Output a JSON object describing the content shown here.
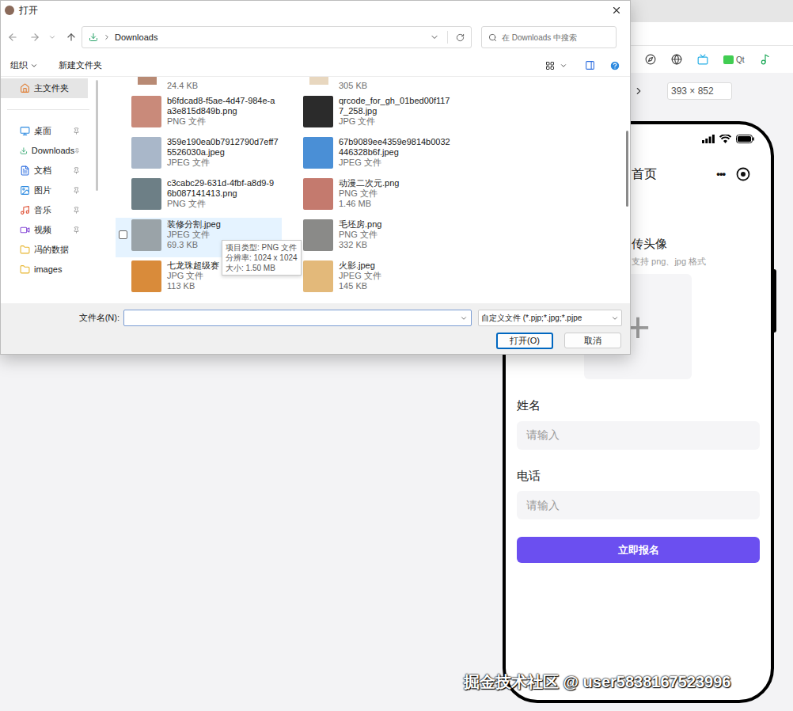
{
  "dialog": {
    "title": "打开",
    "address": {
      "path": "Downloads"
    },
    "search": {
      "placeholder": "在 Downloads 中搜索"
    },
    "toolbar": {
      "organize": "组织",
      "new_folder": "新建文件夹"
    },
    "nav": [
      {
        "label": "主文件夹",
        "selected": true,
        "pinned": false
      },
      {
        "label": "桌面",
        "selected": false,
        "pinned": true
      },
      {
        "label": "Downloads",
        "selected": false,
        "pinned": true
      },
      {
        "label": "文档",
        "selected": false,
        "pinned": true
      },
      {
        "label": "图片",
        "selected": false,
        "pinned": true
      },
      {
        "label": "音乐",
        "selected": false,
        "pinned": true
      },
      {
        "label": "视频",
        "selected": false,
        "pinned": true
      },
      {
        "label": "冯的数据",
        "selected": false,
        "pinned": false
      },
      {
        "label": "images",
        "selected": false,
        "pinned": false
      }
    ],
    "partial_row": [
      "24.4 KB",
      "305 KB"
    ],
    "files": [
      {
        "name_lines": [
          "b6fdcad8-f5ae-4d47-984e-a",
          "a3e815d849b.png"
        ],
        "type": "PNG 文件",
        "hovered": false,
        "checked": false
      },
      {
        "name_lines": [
          "qrcode_for_gh_01bed00f117",
          "7_258.jpg"
        ],
        "type": "JPG 文件",
        "hovered": false,
        "checked": false
      },
      {
        "name_lines": [
          "359e190ea0b7912790d7eff7",
          "5526030a.jpeg"
        ],
        "type": "JPEG 文件",
        "hovered": false,
        "checked": false
      },
      {
        "name_lines": [
          "67b9089ee4359e9814b0032",
          "446328b6f.jpeg"
        ],
        "type": "JPEG 文件",
        "hovered": false,
        "checked": false
      },
      {
        "name_lines": [
          "c3cabc29-631d-4fbf-a8d9-9",
          "6b087141413.png"
        ],
        "type": "PNG 文件",
        "hovered": false,
        "checked": false
      },
      {
        "name_lines": [
          "动漫二次元.png"
        ],
        "type": "PNG 文件",
        "size": "1.46 MB",
        "hovered": false,
        "checked": false
      },
      {
        "name_lines": [
          "装修分割.jpeg"
        ],
        "type": "JPEG 文件",
        "size": "69.3 KB",
        "hovered": true,
        "checked": false
      },
      {
        "name_lines": [
          "毛坯房.png"
        ],
        "type": "PNG 文件",
        "size": "332 KB",
        "hovered": false,
        "checked": false
      },
      {
        "name_lines": [
          "七龙珠超级赛"
        ],
        "type": "JPG 文件",
        "size": "113 KB",
        "hovered": false,
        "checked": false
      },
      {
        "name_lines": [
          "火影.jpeg"
        ],
        "type": "JPEG 文件",
        "size": "145 KB",
        "hovered": false,
        "checked": false
      }
    ],
    "tooltip": [
      "项目类型: PNG 文件",
      "分辨率: 1024 x 1024",
      "大小: 1.50 MB"
    ],
    "filename": {
      "label": "文件名(N):",
      "value": ""
    },
    "filter": "自定义文件 (*.pjp;*.jpg;*.pjpe",
    "buttons": [
      {
        "label": "打开(O)",
        "primary": true
      },
      {
        "label": "取消",
        "primary": false
      }
    ]
  },
  "simulator": {
    "qt_label": "Qt",
    "size": "393 × 852"
  },
  "page": {
    "title": "首页",
    "menu": "•••",
    "upload": {
      "label": "传头像",
      "hint": "支持 png、jpg 格式",
      "plus": "+"
    },
    "fields": [
      {
        "label": "姓名",
        "placeholder": "请输入"
      },
      {
        "label": "电话",
        "placeholder": "请输入"
      }
    ],
    "submit": "立即报名"
  },
  "watermark": "掘金技术社区 @ user5838167523996"
}
